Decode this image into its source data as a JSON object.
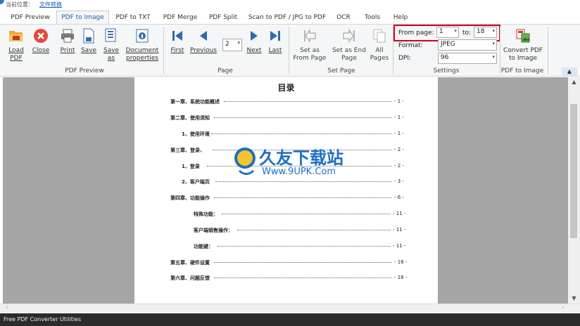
{
  "breadcrumb": {
    "prefix": "当前位置：",
    "link": "文件转换"
  },
  "tabs": [
    "PDF Preview",
    "PDF to Image",
    "PDF to TXT",
    "PDF Merge",
    "PDF Split",
    "Scan to PDF / JPG to PDF",
    "OCR",
    "Tools",
    "Help"
  ],
  "ribbon": {
    "preview": {
      "load": "Load PDF",
      "close": "Close",
      "print": "Print",
      "save": "Save",
      "save_as": "Save as",
      "doc_props": "Document properties",
      "group": "PDF Preview"
    },
    "page": {
      "first": "First",
      "previous": "Previous",
      "current": "2",
      "next": "Next",
      "last": "Last",
      "group": "Page"
    },
    "set_page": {
      "from": "Set as From Page",
      "end": "Set as End Page",
      "all": "All Pages",
      "group": "Set Page"
    },
    "settings": {
      "from_label": "From page:",
      "from_value": "1",
      "to_label": "to:",
      "to_value": "18",
      "format_label": "Format:",
      "format_value": "JPEG",
      "dpi_label": "DPI:",
      "dpi_value": "96",
      "group": "Settings"
    },
    "convert": {
      "label": "Convert PDF to Image",
      "group": "PDF to Image"
    }
  },
  "document": {
    "title": "目录",
    "toc": [
      {
        "text": "第一章、系统功能概述",
        "page": "- 1 -"
      },
      {
        "text": "第二章、使用须知",
        "page": "- 1 -"
      },
      {
        "text": "1、使用环境",
        "page": "- 1 -"
      },
      {
        "text": "第三章、登录、",
        "page": "- 2 -"
      },
      {
        "text": "1、登录",
        "page": "- 2 -"
      },
      {
        "text": "2、客户端页",
        "page": "- 3 -"
      },
      {
        "text": "第四章、功能操作",
        "page": "- 6 -"
      },
      {
        "text": "特殊功能：",
        "page": "- 11 -"
      },
      {
        "text": "客户端销售操作：",
        "page": "- 11 -"
      },
      {
        "text": "功能键：",
        "page": "- 11 -"
      },
      {
        "text": "第五章、硬件设置",
        "page": "- 16 -"
      },
      {
        "text": "第六章、问题反馈",
        "page": "- 16 -"
      }
    ]
  },
  "watermark": {
    "name": "久友下载站",
    "url": "Www.9UPK.Com"
  },
  "status": "Free PDF Converter Utilities",
  "colors": {
    "accent": "#1a5fb4",
    "highlight_frame": "#d0021b",
    "status_bg": "#2b2b2b",
    "viewer_bg": "#a5a5a5"
  }
}
